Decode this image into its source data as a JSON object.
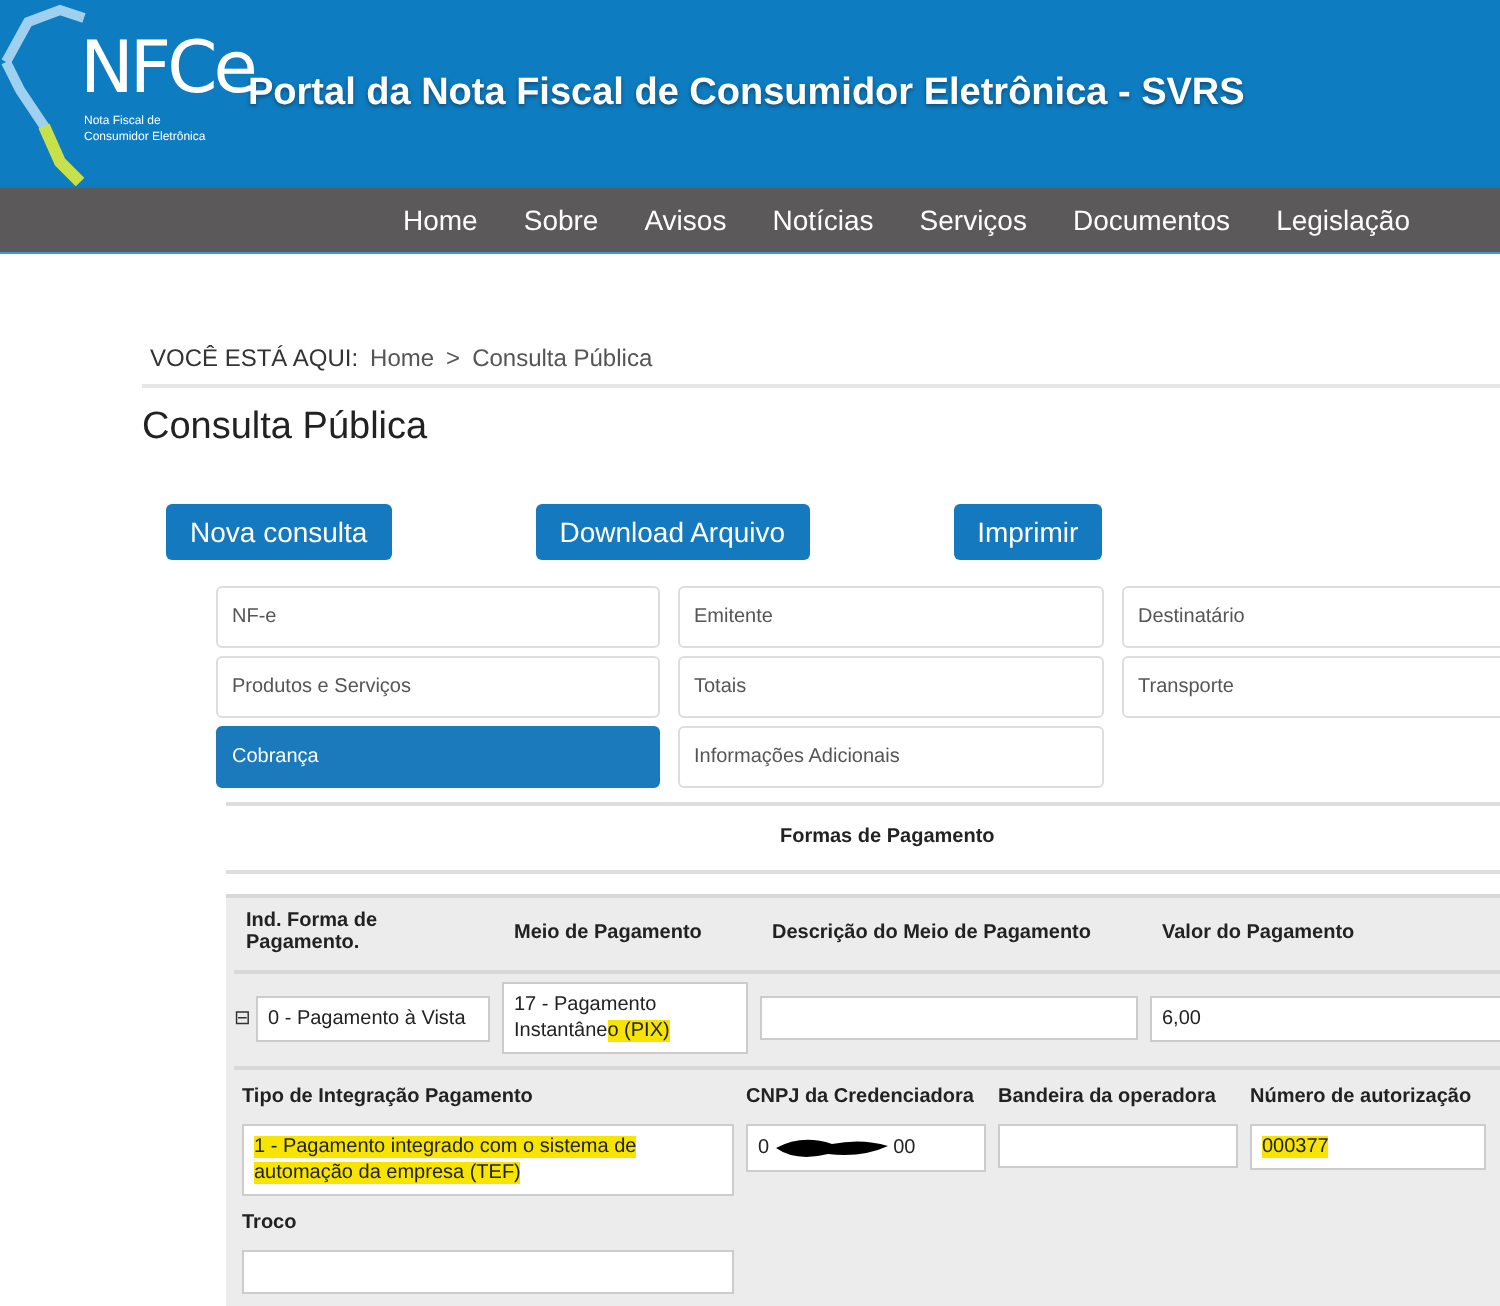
{
  "header": {
    "logo_text": "NFCe",
    "logo_caption": "Nota Fiscal de Consumidor Eletrônica",
    "title": "Portal da Nota Fiscal de Consumidor Eletrônica - SVRS"
  },
  "nav": [
    "Home",
    "Sobre",
    "Avisos",
    "Notícias",
    "Serviços",
    "Documentos",
    "Legislação"
  ],
  "breadcrumb": {
    "label": "VOCÊ ESTÁ AQUI:",
    "items": [
      "Home",
      "Consulta Pública"
    ],
    "separator": ">"
  },
  "page_title": "Consulta Pública",
  "buttons": [
    "Nova consulta",
    "Download Arquivo",
    "Imprimir"
  ],
  "tabs": [
    {
      "label": "NF-e",
      "selected": false
    },
    {
      "label": "Emitente",
      "selected": false
    },
    {
      "label": "Destinatário",
      "selected": false
    },
    {
      "label": "Produtos e Serviços",
      "selected": false
    },
    {
      "label": "Totais",
      "selected": false
    },
    {
      "label": "Transporte",
      "selected": false
    },
    {
      "label": "Cobrança",
      "selected": true
    },
    {
      "label": "Informações Adicionais",
      "selected": false
    }
  ],
  "section_title": "Formas de Pagamento",
  "payment": {
    "expand_icon": "⊟",
    "columns": [
      {
        "label": "Ind. Forma de Pagamento.",
        "value": [
          {
            "text": "0 - Pagamento à Vista",
            "highlighted": false
          }
        ]
      },
      {
        "label": "Meio de Pagamento",
        "value": [
          {
            "text": "17 - Pagamento Instantâne",
            "highlighted": false
          },
          {
            "text": "o (PIX)",
            "highlighted": true
          }
        ]
      },
      {
        "label": "Descrição do Meio de Pagamento"
      },
      {
        "label": "Valor do Pagamento",
        "value": [
          {
            "text": "6,00",
            "highlighted": false
          }
        ]
      }
    ]
  },
  "details": {
    "fields": [
      {
        "label": "Tipo de Integração Pagamento",
        "kind": "text",
        "value": [
          {
            "text": "1 - Pagamento integrado com o sistema de automação da empresa (TEF)",
            "highlighted": true
          }
        ]
      },
      {
        "label": "CNPJ da Credenciadora",
        "kind": "redacted",
        "value_start": "0",
        "value_end": "00"
      },
      {
        "label": "Bandeira da operadora",
        "kind": "text"
      },
      {
        "label": "Número de autorização",
        "kind": "text",
        "value": [
          {
            "text": "000377",
            "highlighted": true
          }
        ]
      },
      {
        "label": "Troco",
        "kind": "text"
      }
    ]
  }
}
